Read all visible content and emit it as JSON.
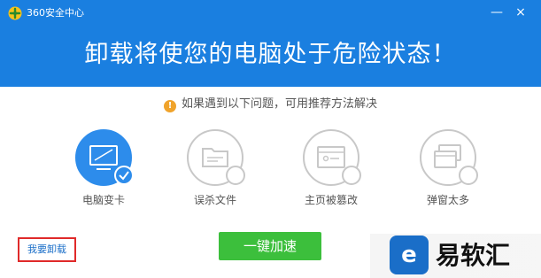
{
  "window": {
    "app_title": "360安全中心",
    "minimize_glyph": "—",
    "close_glyph": "×"
  },
  "header": {
    "headline": "卸载将使您的电脑处于危险状态！"
  },
  "tip": {
    "icon": "info-icon",
    "icon_glyph": "!",
    "text": "如果遇到以下问题，可用推荐方法解决"
  },
  "options": [
    {
      "label": "电脑变卡",
      "icon": "monitor-icon",
      "selected": true
    },
    {
      "label": "误杀文件",
      "icon": "folder-icon",
      "selected": false
    },
    {
      "label": "主页被篡改",
      "icon": "browser-page-icon",
      "selected": false
    },
    {
      "label": "弹窗太多",
      "icon": "popup-windows-icon",
      "selected": false
    }
  ],
  "footer": {
    "uninstall_link": "我要卸载",
    "speed_button": "一键加速"
  },
  "watermark": {
    "logo_glyph": "e",
    "text": "易软汇"
  },
  "colors": {
    "header_blue": "#1a7fe0",
    "accent_blue": "#2d8ceb",
    "green_button": "#3cbf3c",
    "highlight_red": "#e02a2a",
    "tip_orange": "#f0a32b"
  }
}
